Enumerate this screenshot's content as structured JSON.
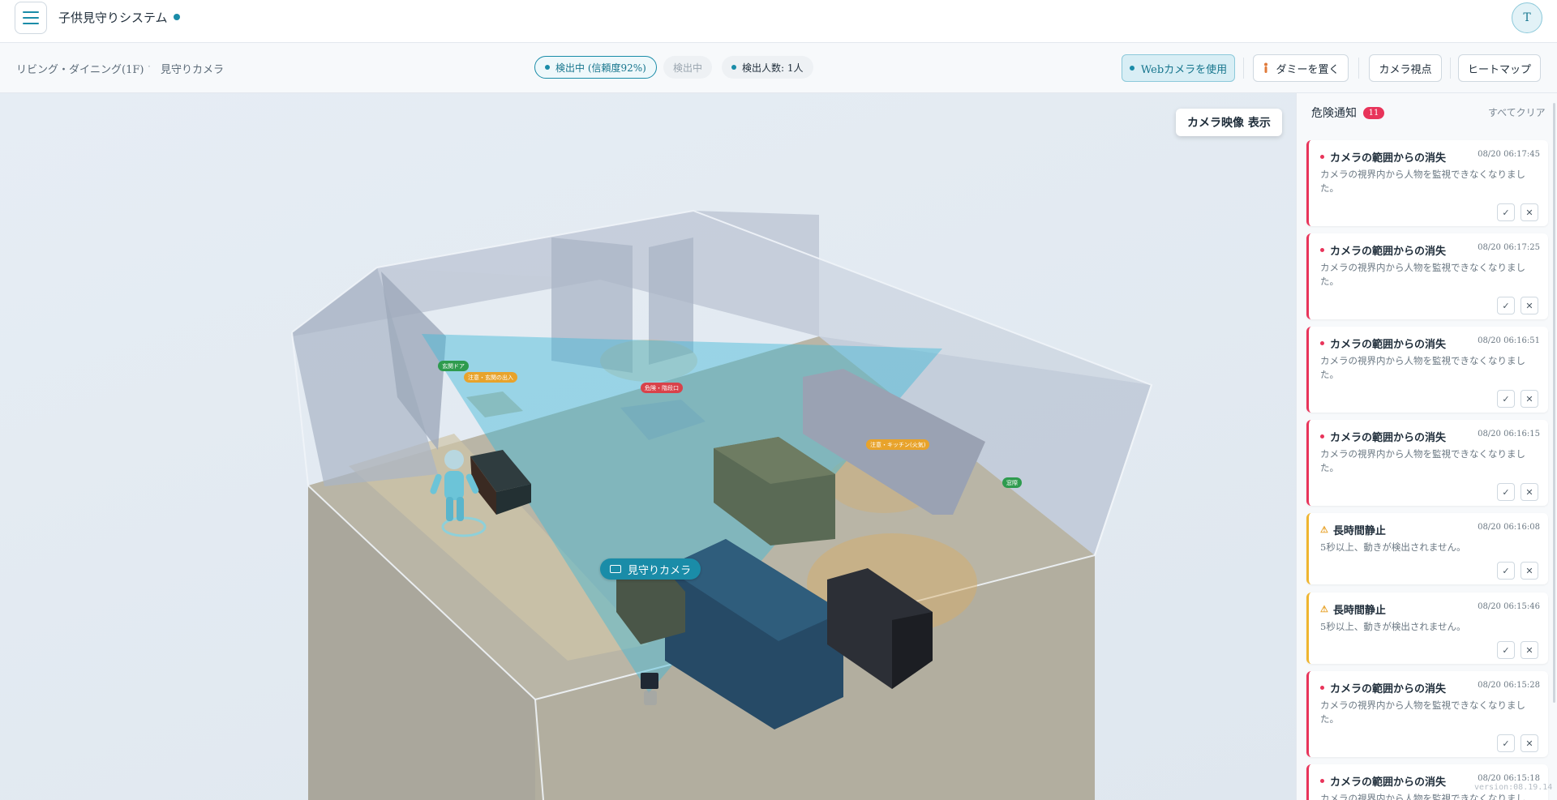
{
  "header": {
    "app_title": "子供見守りシステム",
    "avatar_initial": "T"
  },
  "toolbar": {
    "breadcrumb_room": "リビング・ダイニング(1F)",
    "breadcrumb_sep": "·",
    "breadcrumb_camera": "見守りカメラ",
    "detect_pill": "検出中 (信頼度92%)",
    "status_pill": "検出中",
    "count_pill": "検出人数: 1人",
    "web_camera_button": "Webカメラを使用",
    "dummy_button": "ダミーを置く",
    "camera_view_button": "カメラ視点",
    "heatmap_button": "ヒートマップ"
  },
  "viewport": {
    "camera_feed_toggle": "カメラ映像 表示",
    "camera_label": "見守りカメラ",
    "tag_entrance_door": "玄関ドア",
    "tag_entrance_warning": "注意・玄関の出入",
    "tag_danger_stairs": "危険・階段口",
    "tag_kitchen_warning": "注意・キッチン(火気)",
    "tag_window": "窓際"
  },
  "alerts": {
    "title": "危険通知",
    "count": "11",
    "clear_all": "すべてクリア",
    "items": [
      {
        "kind": "danger",
        "title": "カメラの範囲からの消失",
        "time": "08/20 06:17:45",
        "message": "カメラの視界内から人物を監視できなくなりました。"
      },
      {
        "kind": "danger",
        "title": "カメラの範囲からの消失",
        "time": "08/20 06:17:25",
        "message": "カメラの視界内から人物を監視できなくなりました。"
      },
      {
        "kind": "danger",
        "title": "カメラの範囲からの消失",
        "time": "08/20 06:16:51",
        "message": "カメラの視界内から人物を監視できなくなりました。"
      },
      {
        "kind": "danger",
        "title": "カメラの範囲からの消失",
        "time": "08/20 06:16:15",
        "message": "カメラの視界内から人物を監視できなくなりました。"
      },
      {
        "kind": "warning",
        "title": "長時間静止",
        "time": "08/20 06:16:08",
        "message": "5秒以上、動きが検出されません。"
      },
      {
        "kind": "warning",
        "title": "長時間静止",
        "time": "08/20 06:15:46",
        "message": "5秒以上、動きが検出されません。"
      },
      {
        "kind": "danger",
        "title": "カメラの範囲からの消失",
        "time": "08/20 06:15:28",
        "message": "カメラの視界内から人物を監視できなくなりました。"
      },
      {
        "kind": "danger",
        "title": "カメラの範囲からの消失",
        "time": "08/20 06:15:18",
        "message": "カメラの視界内から人物を監視できなくなりました。"
      }
    ],
    "ack_symbol": "✓",
    "dismiss_symbol": "✕"
  },
  "footer": {
    "version": "version:08.19.14"
  },
  "colors": {
    "accent": "#1a8ca8",
    "danger": "#e8345a",
    "warning": "#efb52f",
    "safe_tag": "#2e9b4e"
  }
}
